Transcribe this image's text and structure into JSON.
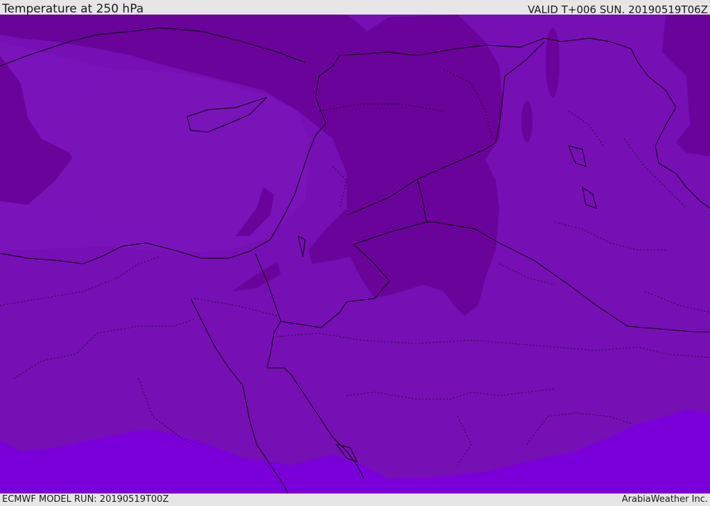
{
  "header": {
    "title": "Temperature at 250 hPa",
    "valid_time": "VALID T+006 SUN. 20190519T06Z"
  },
  "footer": {
    "model_run": "ECMWF MODEL RUN: 20190519T00Z",
    "credit": "ArabiaWeather Inc."
  },
  "map": {
    "colors": {
      "band_warm": "#7a00da",
      "band_mid": "#740fb2",
      "band_light": "#7812b6",
      "band_dark": "#6a0399",
      "coastline": "#000000"
    }
  }
}
